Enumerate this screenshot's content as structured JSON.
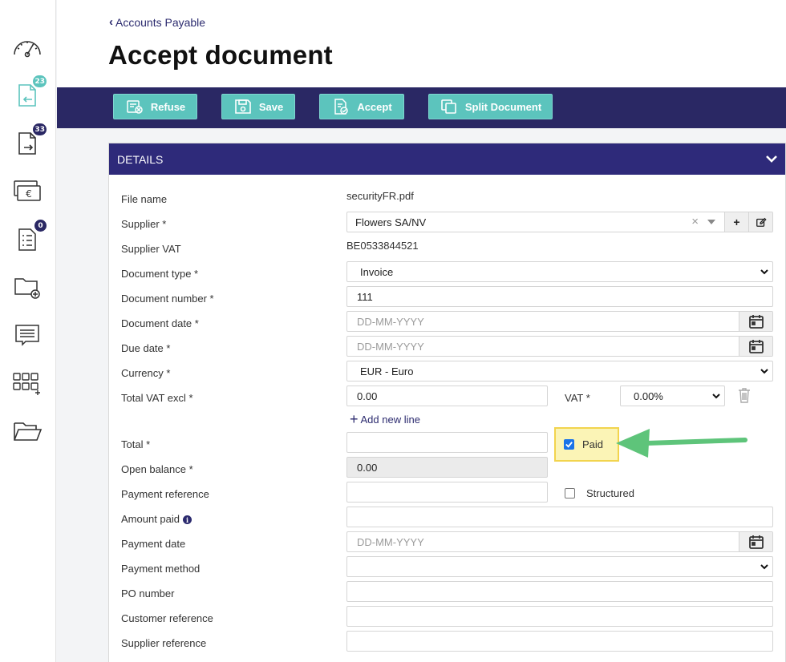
{
  "sidebar": {
    "items": [
      {
        "icon": "gauge-icon"
      },
      {
        "icon": "inbox-document-icon",
        "badge": "23",
        "badge_color": "#5cc4bd"
      },
      {
        "icon": "outbox-document-icon",
        "badge": "33",
        "badge_color": "#2a2864"
      },
      {
        "icon": "euro-payment-icon"
      },
      {
        "icon": "checklist-document-icon",
        "badge": "0",
        "badge_color": "#2a2864"
      },
      {
        "icon": "folder-add-icon"
      },
      {
        "icon": "message-icon"
      },
      {
        "icon": "grid-add-icon"
      },
      {
        "icon": "open-folder-icon"
      }
    ]
  },
  "header": {
    "breadcrumb": "Accounts Payable",
    "title": "Accept document"
  },
  "toolbar": {
    "refuse_label": "Refuse",
    "save_label": "Save",
    "accept_label": "Accept",
    "split_label": "Split Document"
  },
  "details": {
    "heading": "DETAILS",
    "labels": {
      "file_name": "File name",
      "supplier": "Supplier *",
      "supplier_vat": "Supplier VAT",
      "document_type": "Document type *",
      "document_number": "Document number *",
      "document_date": "Document date *",
      "due_date": "Due date *",
      "currency": "Currency *",
      "total_vat_excl": "Total VAT excl *",
      "vat": "VAT *",
      "total": "Total *",
      "open_balance": "Open balance *",
      "payment_reference": "Payment reference",
      "amount_paid": "Amount paid",
      "payment_date": "Payment date",
      "payment_method": "Payment method",
      "po_number": "PO number",
      "customer_reference": "Customer reference",
      "supplier_reference": "Supplier reference"
    },
    "values": {
      "file_name": "securityFR.pdf",
      "supplier": "Flowers SA/NV",
      "supplier_vat": "BE0533844521",
      "document_type": "Invoice",
      "document_number": "111",
      "document_date_placeholder": "DD-MM-YYYY",
      "due_date_placeholder": "DD-MM-YYYY",
      "currency": "EUR - Euro",
      "total_vat_excl": "0.00",
      "vat": "0.00%",
      "total": "",
      "open_balance": "0.00",
      "payment_reference": "",
      "amount_paid": "",
      "payment_date_placeholder": "DD-MM-YYYY",
      "payment_method": "",
      "po_number": "",
      "customer_reference": "",
      "supplier_reference": ""
    },
    "add_line_label": "Add new line",
    "paid_label": "Paid",
    "paid_checked": true,
    "structured_label": "Structured",
    "structured_checked": false
  },
  "colors": {
    "toolbar_bg": "#2a2864",
    "panel_head_bg": "#2e2a7a",
    "button_bg": "#5cc4bd",
    "highlight_bg": "#fbf4b6",
    "arrow": "#5ec47a"
  }
}
